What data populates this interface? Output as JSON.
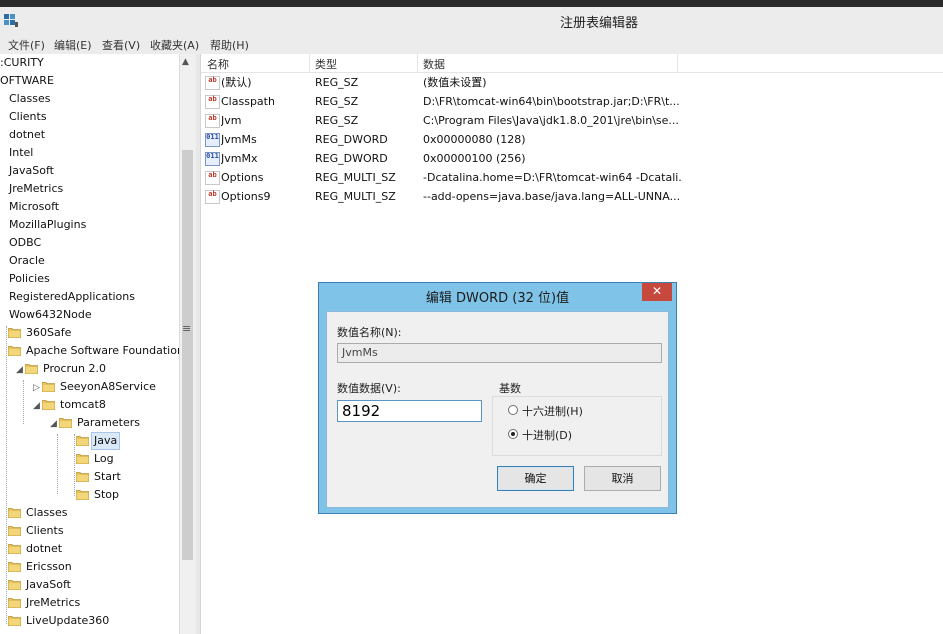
{
  "window": {
    "title": "注册表编辑器"
  },
  "menu": [
    "文件(F)",
    "编辑(E)",
    "查看(V)",
    "收藏夹(A)",
    "帮助(H)"
  ],
  "tree": [
    {
      "label": ":CURITY",
      "indent": 0,
      "folder": false,
      "arrow": ""
    },
    {
      "label": "OFTWARE",
      "indent": 0,
      "folder": false,
      "arrow": ""
    },
    {
      "label": "Classes",
      "indent": 1,
      "folder": false,
      "arrow": ""
    },
    {
      "label": "Clients",
      "indent": 1,
      "folder": false,
      "arrow": ""
    },
    {
      "label": "dotnet",
      "indent": 1,
      "folder": false,
      "arrow": ""
    },
    {
      "label": "Intel",
      "indent": 1,
      "folder": false,
      "arrow": ""
    },
    {
      "label": "JavaSoft",
      "indent": 1,
      "folder": false,
      "arrow": ""
    },
    {
      "label": "JreMetrics",
      "indent": 1,
      "folder": false,
      "arrow": ""
    },
    {
      "label": "Microsoft",
      "indent": 1,
      "folder": false,
      "arrow": ""
    },
    {
      "label": "MozillaPlugins",
      "indent": 1,
      "folder": false,
      "arrow": ""
    },
    {
      "label": "ODBC",
      "indent": 1,
      "folder": false,
      "arrow": ""
    },
    {
      "label": "Oracle",
      "indent": 1,
      "folder": false,
      "arrow": ""
    },
    {
      "label": "Policies",
      "indent": 1,
      "folder": false,
      "arrow": ""
    },
    {
      "label": "RegisteredApplications",
      "indent": 1,
      "folder": false,
      "arrow": ""
    },
    {
      "label": "Wow6432Node",
      "indent": 1,
      "folder": false,
      "arrow": ""
    },
    {
      "label": "360Safe",
      "indent": 2,
      "folder": true,
      "arrow": ""
    },
    {
      "label": "Apache Software Foundation",
      "indent": 2,
      "folder": true,
      "arrow": ""
    },
    {
      "label": "Procrun 2.0",
      "indent": 3,
      "folder": true,
      "arrow": "◢"
    },
    {
      "label": "SeeyonA8Service",
      "indent": 4,
      "folder": true,
      "arrow": "▷"
    },
    {
      "label": "tomcat8",
      "indent": 4,
      "folder": true,
      "arrow": "◢"
    },
    {
      "label": "Parameters",
      "indent": 5,
      "folder": true,
      "arrow": "◢"
    },
    {
      "label": "Java",
      "indent": 6,
      "folder": true,
      "arrow": "",
      "selected": true
    },
    {
      "label": "Log",
      "indent": 6,
      "folder": true,
      "arrow": ""
    },
    {
      "label": "Start",
      "indent": 6,
      "folder": true,
      "arrow": ""
    },
    {
      "label": "Stop",
      "indent": 6,
      "folder": true,
      "arrow": ""
    },
    {
      "label": "Classes",
      "indent": 2,
      "folder": true,
      "arrow": ""
    },
    {
      "label": "Clients",
      "indent": 2,
      "folder": true,
      "arrow": ""
    },
    {
      "label": "dotnet",
      "indent": 2,
      "folder": true,
      "arrow": ""
    },
    {
      "label": "Ericsson",
      "indent": 2,
      "folder": true,
      "arrow": ""
    },
    {
      "label": "JavaSoft",
      "indent": 2,
      "folder": true,
      "arrow": ""
    },
    {
      "label": "JreMetrics",
      "indent": 2,
      "folder": true,
      "arrow": ""
    },
    {
      "label": "LiveUpdate360",
      "indent": 2,
      "folder": true,
      "arrow": ""
    }
  ],
  "columns": {
    "name": "名称",
    "type": "类型",
    "data": "数据"
  },
  "values": [
    {
      "icon": "ab",
      "kind": "sz",
      "name": "(默认)",
      "type": "REG_SZ",
      "data": "(数值未设置)"
    },
    {
      "icon": "ab",
      "kind": "sz",
      "name": "Classpath",
      "type": "REG_SZ",
      "data": "D:\\FR\\tomcat-win64\\bin\\bootstrap.jar;D:\\FR\\t..."
    },
    {
      "icon": "ab",
      "kind": "sz",
      "name": "Jvm",
      "type": "REG_SZ",
      "data": "C:\\Program Files\\Java\\jdk1.8.0_201\\jre\\bin\\se..."
    },
    {
      "icon": "011",
      "kind": "dw",
      "name": "JvmMs",
      "type": "REG_DWORD",
      "data": "0x00000080 (128)"
    },
    {
      "icon": "011",
      "kind": "dw",
      "name": "JvmMx",
      "type": "REG_DWORD",
      "data": "0x00000100 (256)"
    },
    {
      "icon": "ab",
      "kind": "sz",
      "name": "Options",
      "type": "REG_MULTI_SZ",
      "data": "-Dcatalina.home=D:\\FR\\tomcat-win64 -Dcatali..."
    },
    {
      "icon": "ab",
      "kind": "sz",
      "name": "Options9",
      "type": "REG_MULTI_SZ",
      "data": "--add-opens=java.base/java.lang=ALL-UNNA..."
    }
  ],
  "dialog": {
    "title": "编辑 DWORD (32 位)值",
    "close": "✕",
    "name_label": "数值名称(N):",
    "name_value": "JvmMs",
    "data_label": "数值数据(V):",
    "data_value": "8192",
    "base_label": "基数",
    "hex_label": "十六进制(H)",
    "dec_label": "十进制(D)",
    "selected_base": "dec",
    "ok": "确定",
    "cancel": "取消"
  }
}
